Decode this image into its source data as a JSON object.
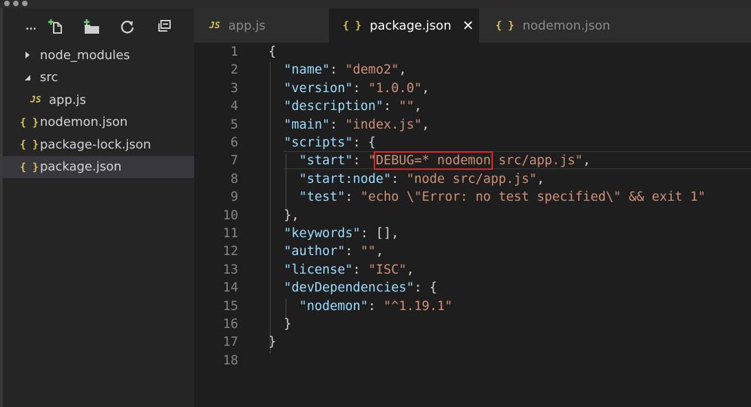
{
  "toolbar": {
    "more_label": "...",
    "icons": [
      "new-file-icon",
      "new-folder-icon",
      "refresh-icon",
      "collapse-all-icon"
    ]
  },
  "tree": [
    {
      "label": "node_modules",
      "type": "folder",
      "expanded": false
    },
    {
      "label": "src",
      "type": "folder",
      "expanded": true
    },
    {
      "label": "app.js",
      "type": "js",
      "badge": "JS"
    },
    {
      "label": "nodemon.json",
      "type": "json",
      "badge": "{ }"
    },
    {
      "label": "package-lock.json",
      "type": "json",
      "badge": "{ }"
    },
    {
      "label": "package.json",
      "type": "json",
      "badge": "{ }",
      "selected": true
    }
  ],
  "tabs": [
    {
      "label": "app.js",
      "badge": "JS"
    },
    {
      "label": "package.json",
      "badge": "{ }",
      "active": true,
      "close": "✕"
    },
    {
      "label": "nodemon.json",
      "badge": "{ }"
    }
  ],
  "editor": {
    "line_numbers": [
      "1",
      "2",
      "3",
      "4",
      "5",
      "6",
      "7",
      "8",
      "9",
      "10",
      "11",
      "12",
      "13",
      "14",
      "15",
      "16",
      "17",
      "18"
    ],
    "highlight_text": "DEBUG=* nodemon",
    "highlight_color": "#e0282a",
    "lines": [
      [
        [
          "p",
          "{"
        ]
      ],
      [
        [
          "k",
          "  \"name\""
        ],
        [
          "p",
          ": "
        ],
        [
          "s",
          "\"demo2\""
        ],
        [
          "p",
          ","
        ]
      ],
      [
        [
          "k",
          "  \"version\""
        ],
        [
          "p",
          ": "
        ],
        [
          "s",
          "\"1.0.0\""
        ],
        [
          "p",
          ","
        ]
      ],
      [
        [
          "k",
          "  \"description\""
        ],
        [
          "p",
          ": "
        ],
        [
          "s",
          "\"\""
        ],
        [
          "p",
          ","
        ]
      ],
      [
        [
          "k",
          "  \"main\""
        ],
        [
          "p",
          ": "
        ],
        [
          "s",
          "\"index.js\""
        ],
        [
          "p",
          ","
        ]
      ],
      [
        [
          "k",
          "  \"scripts\""
        ],
        [
          "p",
          ": {"
        ]
      ],
      [
        [
          "k",
          "    \"start\""
        ],
        [
          "p",
          ": "
        ],
        [
          "s",
          "\""
        ],
        [
          "s",
          "DEBUG=* nodemon",
          "hl"
        ],
        [
          "s",
          " src/app.js\""
        ],
        [
          "p",
          ","
        ]
      ],
      [
        [
          "k",
          "    \"start:node\""
        ],
        [
          "p",
          ": "
        ],
        [
          "s",
          "\"node src/app.js\""
        ],
        [
          "p",
          ","
        ]
      ],
      [
        [
          "k",
          "    \"test\""
        ],
        [
          "p",
          ": "
        ],
        [
          "s",
          "\"echo \\\"Error: no test specified\\\" && exit 1\""
        ]
      ],
      [
        [
          "p",
          "  },"
        ]
      ],
      [
        [
          "k",
          "  \"keywords\""
        ],
        [
          "p",
          ": [],"
        ]
      ],
      [
        [
          "k",
          "  \"author\""
        ],
        [
          "p",
          ": "
        ],
        [
          "s",
          "\"\""
        ],
        [
          "p",
          ","
        ]
      ],
      [
        [
          "k",
          "  \"license\""
        ],
        [
          "p",
          ": "
        ],
        [
          "s",
          "\"ISC\""
        ],
        [
          "p",
          ","
        ]
      ],
      [
        [
          "k",
          "  \"devDependencies\""
        ],
        [
          "p",
          ": {"
        ]
      ],
      [
        [
          "k",
          "    \"nodemon\""
        ],
        [
          "p",
          ": "
        ],
        [
          "s",
          "\"^1.19.1\""
        ]
      ],
      [
        [
          "p",
          "  }"
        ]
      ],
      [
        [
          "p",
          "}"
        ]
      ],
      [
        [
          "p",
          ""
        ]
      ]
    ]
  },
  "colors": {
    "key": "#9cdcfe",
    "string": "#ce9178",
    "punct": "#d4d4d4",
    "badge": "#d6c35a",
    "background": "#1e1e1e",
    "sidebar": "#252526"
  }
}
